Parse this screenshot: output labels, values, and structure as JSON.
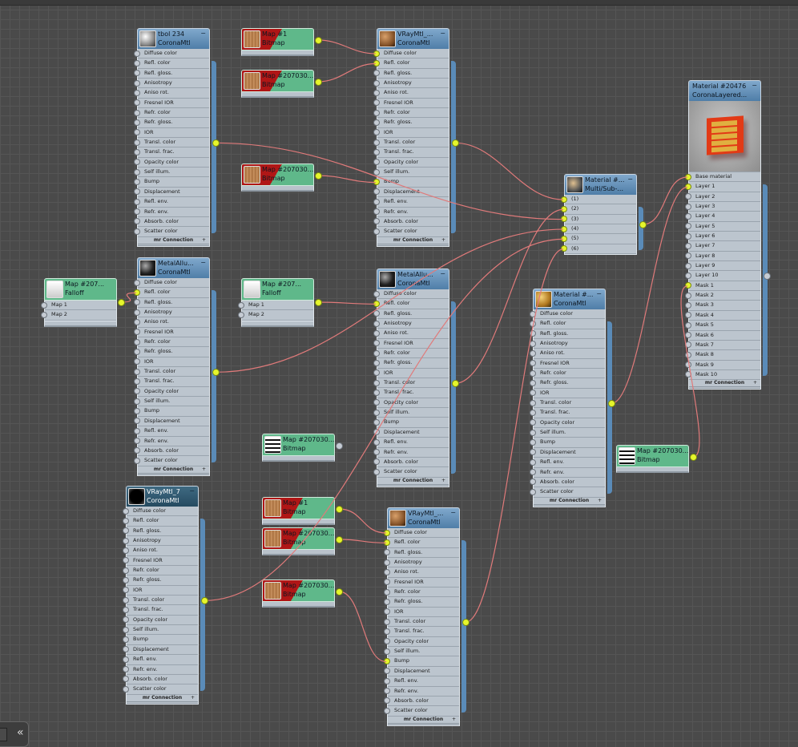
{
  "corona_slots": [
    "Diffuse color",
    "Refl. color",
    "Refl. gloss.",
    "Anisotropy",
    "Aniso rot.",
    "Fresnel IOR",
    "Refr. color",
    "Refr. gloss.",
    "IOR",
    "Transl. color",
    "Transl. frac.",
    "Opacity color",
    "Self illum.",
    "Bump",
    "Displacement",
    "Refl. env.",
    "Refr. env.",
    "Absorb. color",
    "Scatter color"
  ],
  "footer_label": "mr Connection",
  "footer_plus": "+",
  "minimize_glyph": "−",
  "collapse_label": "«",
  "colors": {
    "header": "#5f8fb9",
    "map_green": "#5fb88a",
    "bitmap_red": "#b01616",
    "socket_connected": "#e6f52c",
    "wire": "#e07a7a"
  },
  "materials": [
    {
      "id": "m1",
      "title": "tbol 234",
      "subtitle": "CoronaMtl",
      "thumb": "grey-sphere",
      "type": "corona"
    },
    {
      "id": "m2",
      "title": "VRayMtl_...",
      "subtitle": "CoronaMtl",
      "thumb": "wood-sphere",
      "type": "corona"
    },
    {
      "id": "m3",
      "title": "MetalAllu...",
      "subtitle": "CoronaMtl",
      "thumb": "dark-sphere",
      "type": "corona"
    },
    {
      "id": "m4",
      "title": "MetalAllu...",
      "subtitle": "CoronaMtl",
      "thumb": "dark-sphere",
      "type": "corona"
    },
    {
      "id": "m5",
      "title": "VRayMtl_7",
      "subtitle": "CoronaMtl",
      "thumb": "black-sphere",
      "type": "corona",
      "selected": true
    },
    {
      "id": "m6",
      "title": "VRayMtl_...",
      "subtitle": "CoronaMtl",
      "thumb": "wood-sphere",
      "type": "corona"
    },
    {
      "id": "m7",
      "title": "Material #...",
      "subtitle": "CoronaMtl",
      "thumb": "gold-sphere",
      "type": "corona"
    },
    {
      "id": "m8",
      "title": "Material #...",
      "subtitle": "Multi/Sub-...",
      "thumb": "multi-sphere",
      "slots": [
        "(1)",
        "(2)",
        "(3)",
        "(4)",
        "(5)",
        "(6)"
      ]
    },
    {
      "id": "m9",
      "title": "Material #20476",
      "subtitle": "CoronaLayered...",
      "preview": true,
      "slots": [
        "Base material",
        "Layer 1",
        "Layer 2",
        "Layer 3",
        "Layer 4",
        "Layer 5",
        "Layer 6",
        "Layer 7",
        "Layer 8",
        "Layer 9",
        "Layer 10",
        "Mask 1",
        "Mask 2",
        "Mask 3",
        "Mask 4",
        "Mask 5",
        "Mask 6",
        "Mask 7",
        "Mask 8",
        "Mask 9",
        "Mask 10"
      ]
    }
  ],
  "maps": [
    {
      "id": "b1",
      "title": "Map #1",
      "subtitle": "Bitmap",
      "thumb": "wood"
    },
    {
      "id": "b2",
      "title": "Map #207030...",
      "subtitle": "Bitmap",
      "thumb": "wood"
    },
    {
      "id": "b3",
      "title": "Map #207030...",
      "subtitle": "Bitmap",
      "thumb": "wood"
    },
    {
      "id": "f1",
      "title": "Map #207...",
      "subtitle": "Falloff",
      "thumb": "white",
      "slots": [
        "Map 1",
        "Map 2"
      ]
    },
    {
      "id": "f2",
      "title": "Map #207...",
      "subtitle": "Falloff",
      "thumb": "white",
      "slots": [
        "Map 1",
        "Map 2"
      ]
    },
    {
      "id": "b4",
      "title": "Map #207030...",
      "subtitle": "Bitmap",
      "thumb": "stripes"
    },
    {
      "id": "b5",
      "title": "Map #1",
      "subtitle": "Bitmap",
      "thumb": "wood"
    },
    {
      "id": "b6",
      "title": "Map #207030...",
      "subtitle": "Bitmap",
      "thumb": "wood"
    },
    {
      "id": "b7",
      "title": "Map #207030...",
      "subtitle": "Bitmap",
      "thumb": "wood"
    },
    {
      "id": "b8",
      "title": "Map #207030...",
      "subtitle": "Bitmap",
      "thumb": "stripes"
    }
  ],
  "connections": [
    {
      "from": "b1",
      "to": "m2",
      "slot": "Diffuse color"
    },
    {
      "from": "b2",
      "to": "m2",
      "slot": "Refl. color"
    },
    {
      "from": "b3",
      "to": "m2",
      "slot": "Bump"
    },
    {
      "from": "f1",
      "to": "m3",
      "slot": "Refl. color"
    },
    {
      "from": "f2",
      "to": "m4",
      "slot": "Refl. color"
    },
    {
      "from": "b5",
      "to": "m6",
      "slot": "Diffuse color"
    },
    {
      "from": "b6",
      "to": "m6",
      "slot": "Refl. color"
    },
    {
      "from": "b7",
      "to": "m6",
      "slot": "Bump"
    },
    {
      "from": "m2",
      "to": "m8",
      "slot": "(1)"
    },
    {
      "from": "m4",
      "to": "m8",
      "slot": "(2)"
    },
    {
      "from": "m1",
      "to": "m8",
      "slot": "(3)"
    },
    {
      "from": "m3",
      "to": "m8",
      "slot": "(4)"
    },
    {
      "from": "m5",
      "to": "m8",
      "slot": "(5)"
    },
    {
      "from": "m6",
      "to": "m8",
      "slot": "(6)"
    },
    {
      "from": "m8",
      "to": "m9",
      "slot": "Base material"
    },
    {
      "from": "m7",
      "to": "m9",
      "slot": "Layer 1"
    },
    {
      "from": "b8",
      "to": "m9",
      "slot": "Mask 1"
    }
  ]
}
